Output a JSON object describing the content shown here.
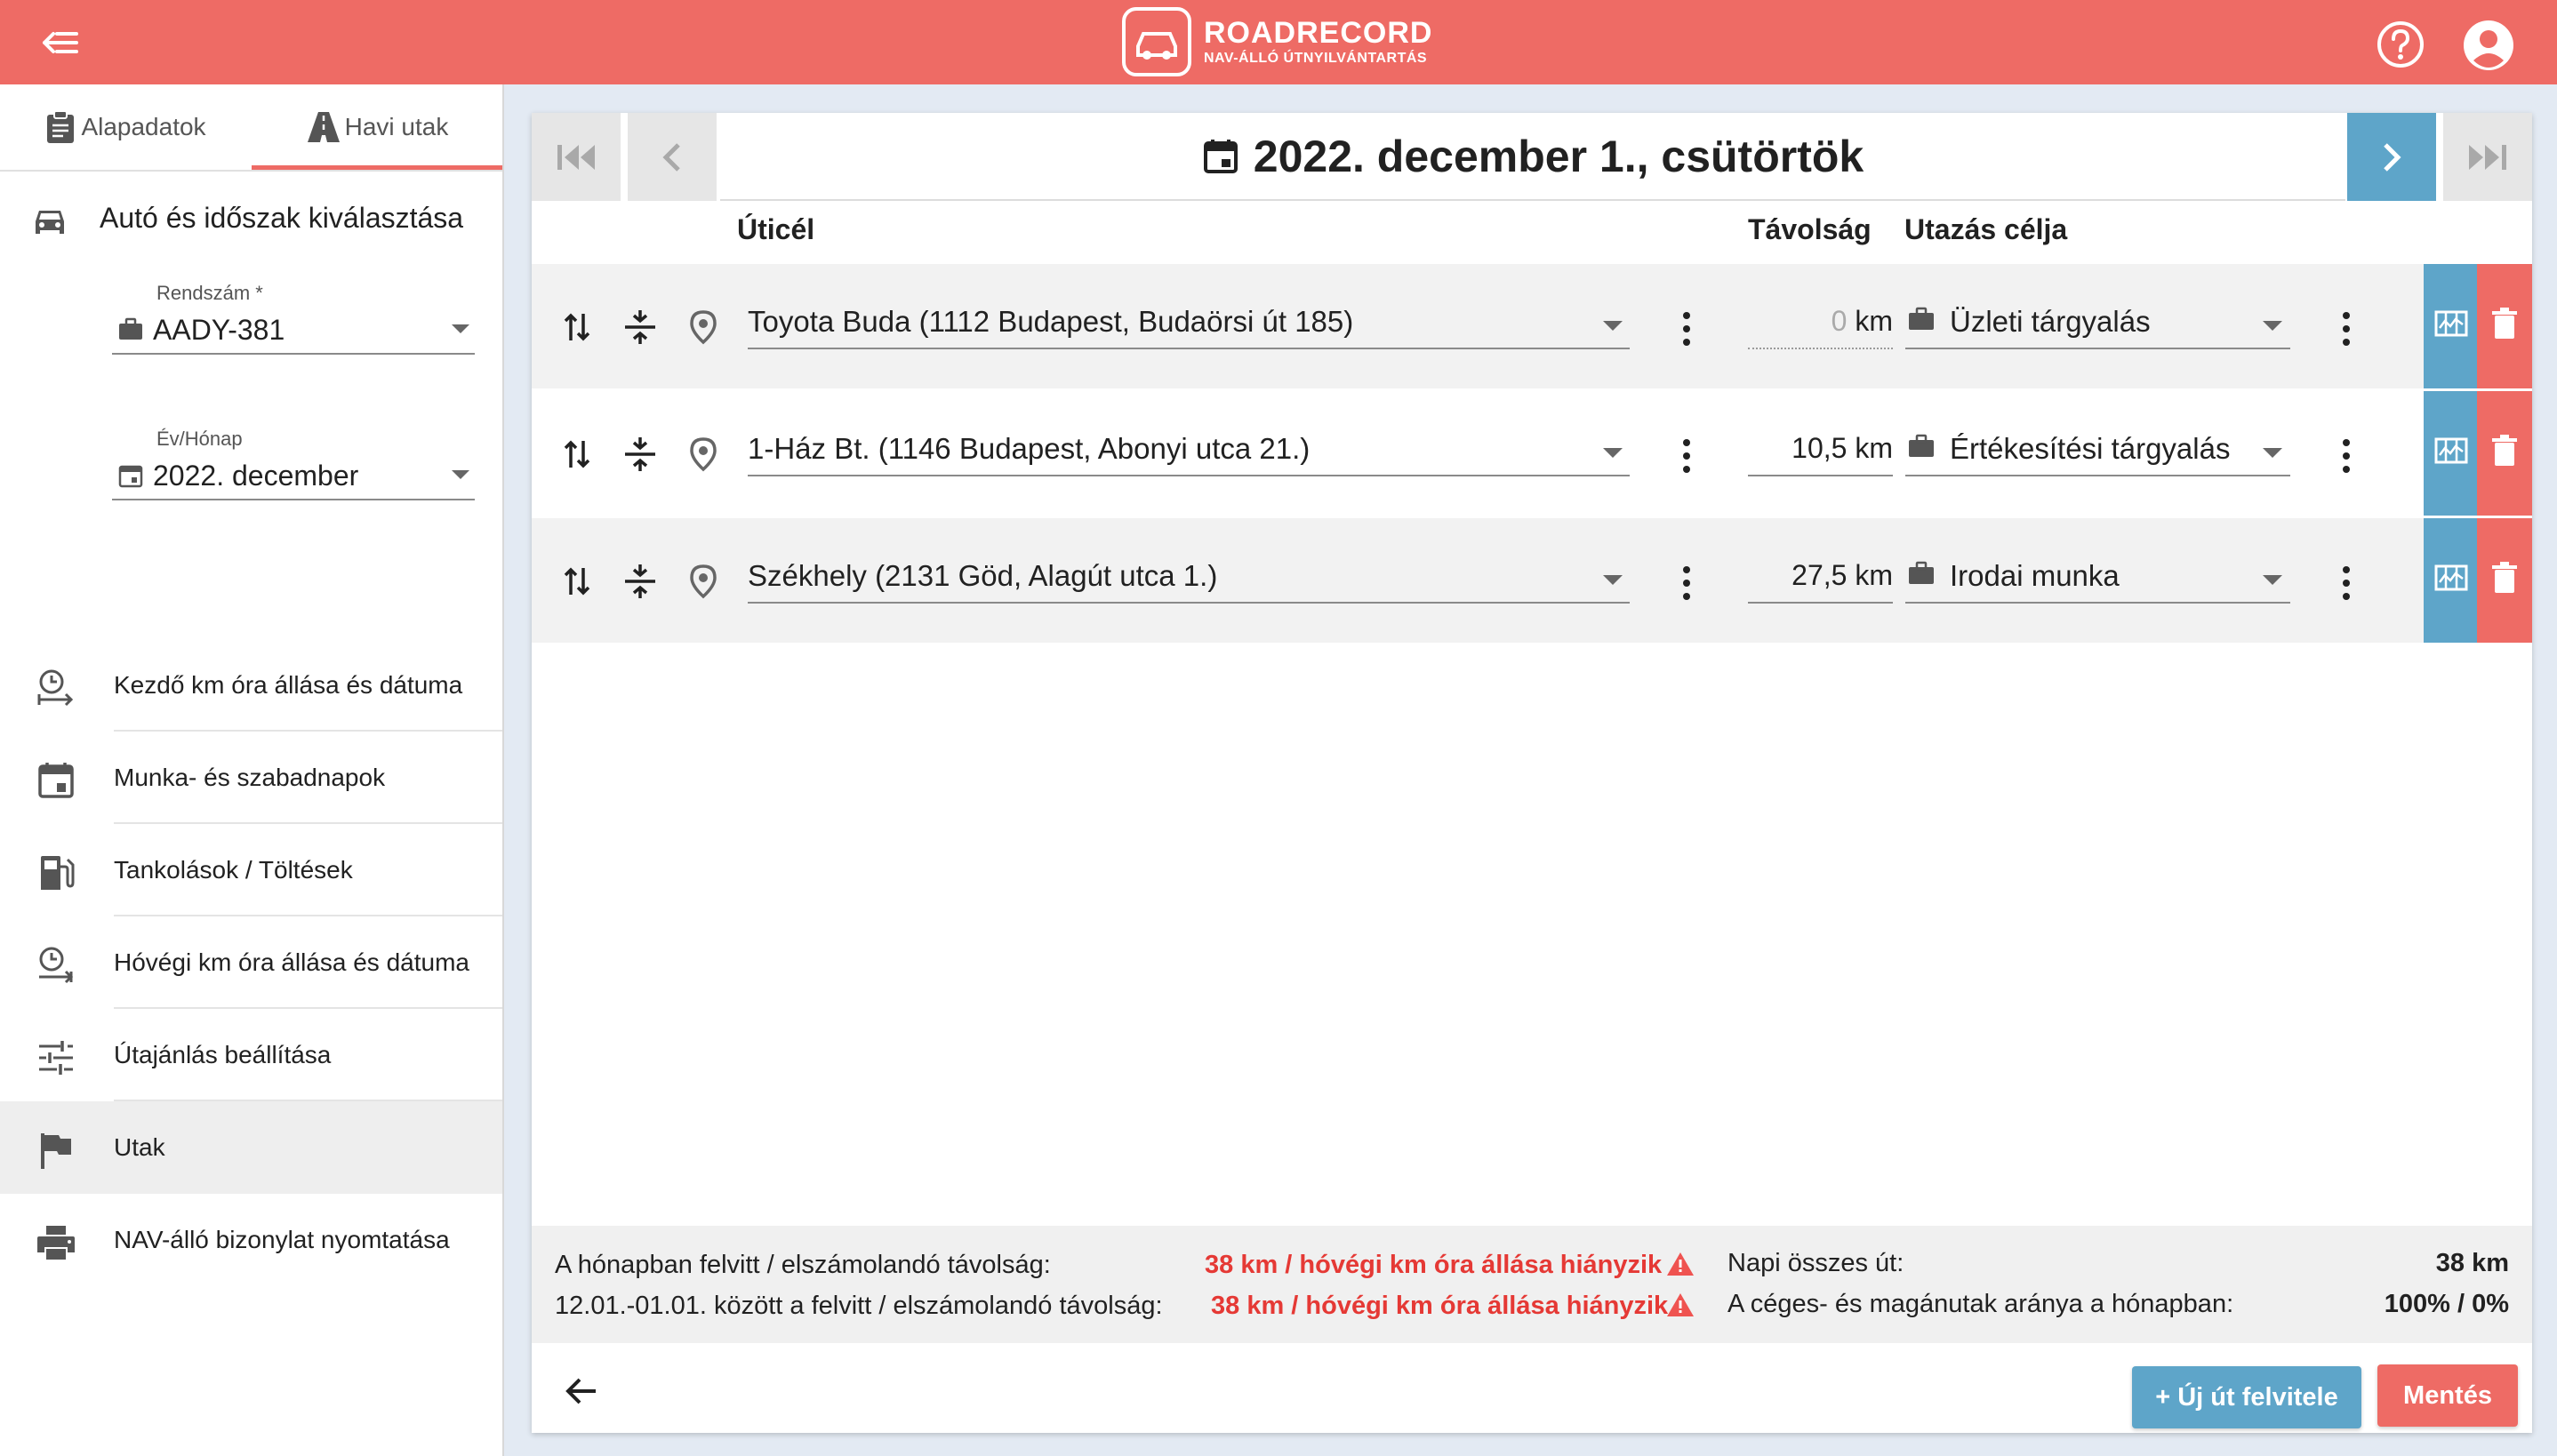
{
  "header": {
    "brand_title": "ROADRECORD",
    "brand_subtitle": "NAV-ÁLLÓ ÚTNYILVÁNTARTÁS",
    "accent_color": "#ee6b65",
    "secondary_color": "#5ea5c9"
  },
  "sidebar": {
    "tabs": [
      {
        "label": "Alapadatok",
        "icon": "clipboard-icon",
        "active": false
      },
      {
        "label": "Havi utak",
        "icon": "road-icon",
        "active": true
      }
    ],
    "section_title": "Autó és időszak kiválasztása",
    "plate_field": {
      "label": "Rendszám *",
      "value": "AADY-381"
    },
    "month_field": {
      "label": "Év/Hónap",
      "value": "2022. december"
    },
    "items": [
      {
        "label": "Kezdő km óra állása és dátuma",
        "icon": "clock-arrow-icon"
      },
      {
        "label": "Munka- és szabadnapok",
        "icon": "calendar-icon"
      },
      {
        "label": "Tankolások / Töltések",
        "icon": "fuel-pump-icon"
      },
      {
        "label": "Hóvégi km óra állása és dátuma",
        "icon": "clock-arrow-icon"
      },
      {
        "label": "Útajánlás beállítása",
        "icon": "sliders-icon"
      },
      {
        "label": "Utak",
        "icon": "flag-icon",
        "active": true
      },
      {
        "label": "NAV-álló bizonylat nyomtatása",
        "icon": "printer-icon"
      }
    ]
  },
  "main": {
    "date_title": "2022. december 1., csütörtök",
    "columns": {
      "destination": "Úticél",
      "distance": "Távolság",
      "purpose": "Utazás célja"
    },
    "trips": [
      {
        "destination": "Toyota Buda (1112 Budapest, Budaörsi út 185)",
        "distance_value": "0",
        "distance_unit": "km",
        "purpose": "Üzleti tárgyalás"
      },
      {
        "destination": "1-Ház Bt. (1146 Budapest, Abonyi utca 21.)",
        "distance_value": "10,5 km",
        "purpose": "Értékesítési tárgyalás"
      },
      {
        "destination": "Székhely (2131 Göd, Alagút utca 1.)",
        "distance_value": "27,5 km",
        "purpose": "Irodai munka"
      }
    ],
    "summary": {
      "month_label": "A hónapban felvitt / elszámolandó távolság:",
      "month_value": "38 km / hóvégi km óra állása hiányzik",
      "period_label": "12.01.-01.01. között a felvitt / elszámolandó távolság:",
      "period_value": "38 km / hóvégi km óra állása hiányzik",
      "daily_label": "Napi összes út:",
      "daily_value": "38 km",
      "ratio_label": "A céges- és magánutak aránya a hónapban:",
      "ratio_value": "100% / 0%"
    },
    "buttons": {
      "new_trip": "+ Új út felvitele",
      "save": "Mentés"
    }
  }
}
